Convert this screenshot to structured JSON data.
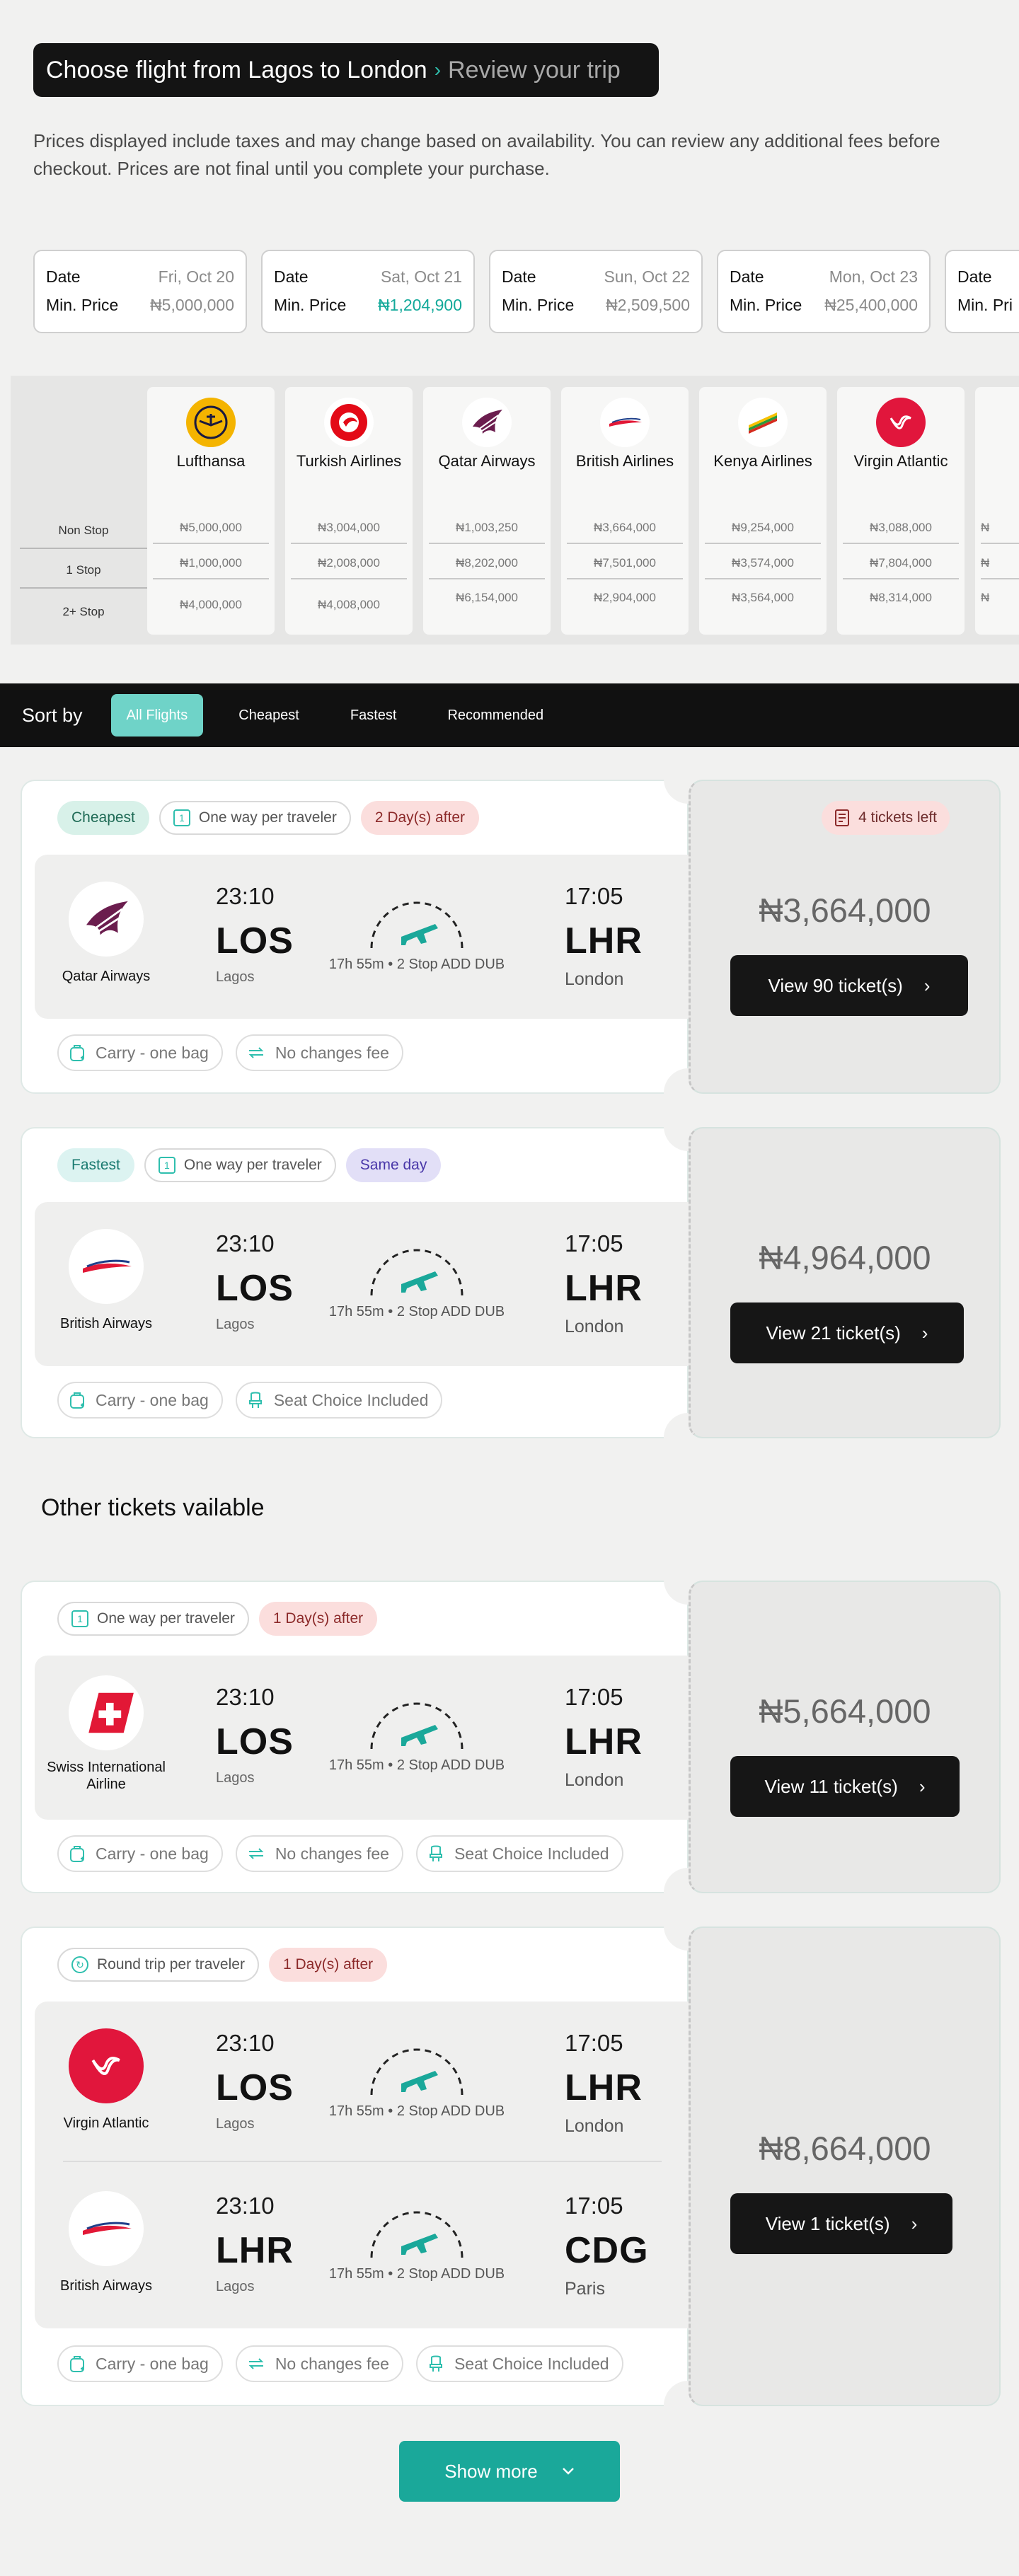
{
  "header": {
    "title_part1": "Choose flight from Lagos to",
    "title_part2": "London",
    "separator": "›",
    "title_part3": "Review your  trip"
  },
  "description": "Prices displayed include taxes and may change based on availability. You can review any additional fees before checkout. Prices are not final until you complete your purchase.",
  "dates": [
    {
      "label": "Date",
      "date": "Fri, Oct 20",
      "price_label": "Min. Price",
      "price": "₦5,000,000"
    },
    {
      "label": "Date",
      "date": "Sat, Oct 21",
      "price_label": "Min. Price",
      "price": "₦1,204,900"
    },
    {
      "label": "Date",
      "date": "Sun, Oct 22",
      "price_label": "Min. Price",
      "price": "₦2,509,500"
    },
    {
      "label": "Date",
      "date": "Mon, Oct 23",
      "price_label": "Min. Price",
      "price": "₦25,400,000"
    },
    {
      "label": "Date",
      "date": "",
      "price_label": "Min. Pri",
      "price": ""
    }
  ],
  "matrix": {
    "row_labels": [
      "Non Stop",
      "1 Stop",
      "2+ Stop"
    ],
    "airlines": [
      {
        "name": "Lufthansa",
        "prices": [
          "₦5,000,000",
          "₦1,000,000",
          "₦4,000,000"
        ]
      },
      {
        "name": "Turkish Airlines",
        "prices": [
          "₦3,004,000",
          "₦2,008,000",
          "₦4,008,000"
        ]
      },
      {
        "name": "Qatar Airways",
        "prices": [
          "₦1,003,250",
          "₦8,202,000",
          "₦6,154,000"
        ]
      },
      {
        "name": "British Airlines",
        "prices": [
          "₦3,664,000",
          "₦7,501,000",
          "₦2,904,000"
        ]
      },
      {
        "name": "Kenya Airlines",
        "prices": [
          "₦9,254,000",
          "₦3,574,000",
          "₦3,564,000"
        ]
      },
      {
        "name": "Virgin Atlantic",
        "prices": [
          "₦3,088,000",
          "₦7,804,000",
          "₦8,314,000"
        ]
      },
      {
        "name": "",
        "prices": [
          "₦",
          "₦",
          "₦"
        ]
      }
    ]
  },
  "sort": {
    "label": "Sort by",
    "tabs": [
      "All Flights",
      "Cheapest",
      "Fastest",
      "Recommended"
    ]
  },
  "tickets": [
    {
      "tags": [
        "Cheapest",
        "One way per traveler",
        "2 Day(s) after"
      ],
      "badge": "4 tickets left",
      "segments": [
        {
          "airline": "Qatar Airways",
          "dep_time": "23:10",
          "dep_code": "LOS",
          "dep_city": "Lagos",
          "duration": "17h 55m • 2 Stop ADD DUB",
          "arr_time": "17:05",
          "arr_code": "LHR",
          "arr_city": "London"
        }
      ],
      "features": [
        "Carry - one bag",
        "No changes fee"
      ],
      "price": "₦3,664,000",
      "button": "View 90 ticket(s)"
    },
    {
      "tags": [
        "Fastest",
        "One way per traveler",
        "Same day"
      ],
      "segments": [
        {
          "airline": "British Airways",
          "dep_time": "23:10",
          "dep_code": "LOS",
          "dep_city": "Lagos",
          "duration": "17h 55m • 2 Stop ADD DUB",
          "arr_time": "17:05",
          "arr_code": "LHR",
          "arr_city": "London"
        }
      ],
      "features": [
        "Carry - one bag",
        "Seat Choice Included"
      ],
      "price": "₦4,964,000",
      "button": "View 21 ticket(s)"
    },
    {
      "tags": [
        "One way per traveler",
        "1 Day(s) after"
      ],
      "segments": [
        {
          "airline": "Swiss International Airline",
          "dep_time": "23:10",
          "dep_code": "LOS",
          "dep_city": "Lagos",
          "duration": "17h 55m • 2 Stop ADD DUB",
          "arr_time": "17:05",
          "arr_code": "LHR",
          "arr_city": "London"
        }
      ],
      "features": [
        "Carry - one bag",
        "No changes fee",
        "Seat Choice Included"
      ],
      "price": "₦5,664,000",
      "button": "View 11 ticket(s)"
    },
    {
      "tags": [
        "Round trip per traveler",
        "1 Day(s) after"
      ],
      "segments": [
        {
          "airline": "Virgin Atlantic",
          "dep_time": "23:10",
          "dep_code": "LOS",
          "dep_city": "Lagos",
          "duration": "17h 55m • 2 Stop ADD DUB",
          "arr_time": "17:05",
          "arr_code": "LHR",
          "arr_city": "London"
        },
        {
          "airline": "British Airways",
          "dep_time": "23:10",
          "dep_code": "LHR",
          "dep_city": "Lagos",
          "duration": "17h 55m • 2 Stop ADD DUB",
          "arr_time": "17:05",
          "arr_code": "CDG",
          "arr_city": "Paris"
        }
      ],
      "features": [
        "Carry - one bag",
        "No changes fee",
        "Seat Choice Included"
      ],
      "price": "₦8,664,000",
      "button": "View 1 ticket(s)"
    }
  ],
  "other_title": "Other tickets vailable",
  "show_more": "Show more",
  "colors": {
    "accent": "#1aa89a",
    "dark": "#141414",
    "tag_red": "#fbdedd"
  }
}
